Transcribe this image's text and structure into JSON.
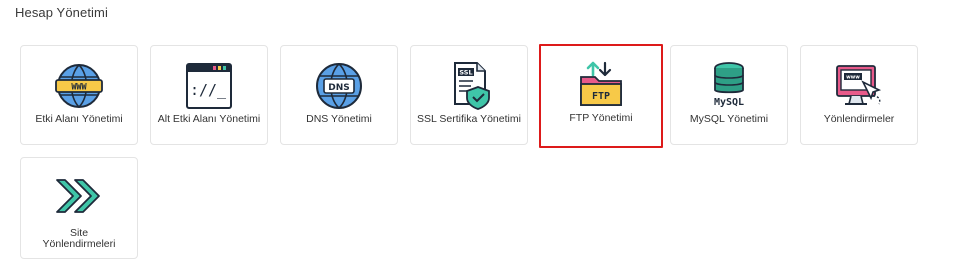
{
  "section": {
    "title": "Hesap Yönetimi"
  },
  "tiles": [
    {
      "label": "Etki Alanı Yönetimi",
      "icon": "www-globe-icon"
    },
    {
      "label": "Alt Etki Alanı Yönetimi",
      "icon": "terminal-window-icon"
    },
    {
      "label": "DNS Yönetimi",
      "icon": "dns-globe-icon"
    },
    {
      "label": "SSL Sertifika Yönetimi",
      "icon": "ssl-certificate-icon"
    },
    {
      "label": "FTP Yönetimi",
      "icon": "ftp-folder-icon",
      "selected": true
    },
    {
      "label": "MySQL Yönetimi",
      "icon": "database-icon"
    },
    {
      "label": "Yönlendirmeler",
      "icon": "redirect-monitor-icon"
    },
    {
      "label": "Site Yönlendirmeleri",
      "icon": "double-arrow-icon"
    }
  ],
  "colors": {
    "selection_border": "#dd1a1a",
    "tile_border": "#e4e4e4",
    "globe_blue": "#4a90d9",
    "teal": "#3fc5a8",
    "dark_navy": "#1e2a3a",
    "yellow": "#f7c948",
    "pink": "#e85a8a"
  }
}
